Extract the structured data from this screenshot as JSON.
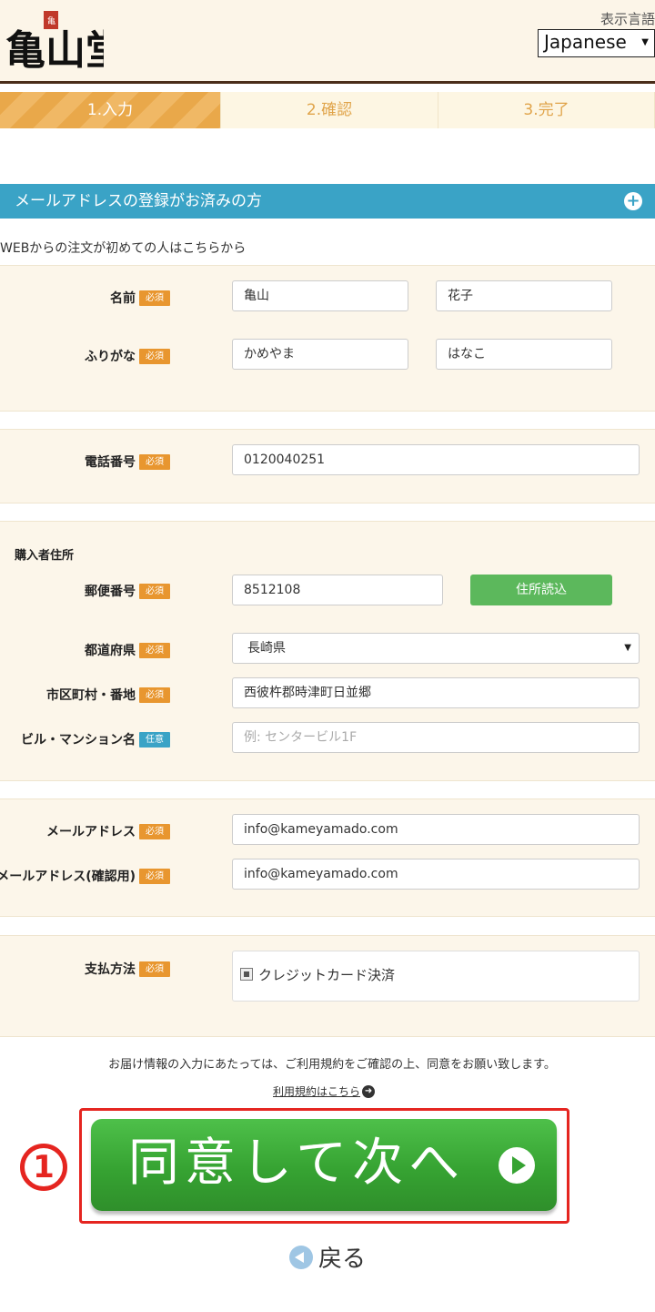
{
  "header": {
    "logo_alt": "亀山堂",
    "lang_label": "表示言語",
    "lang_selected": "Japanese"
  },
  "steps": [
    {
      "label": "1.入力",
      "active": true
    },
    {
      "label": "2.確認",
      "active": false
    },
    {
      "label": "3.完了",
      "active": false
    }
  ],
  "registered_bar": "メールアドレスの登録がお済みの方",
  "first_note": "WEBからの注文が初めての人はこちらから",
  "badges": {
    "required": "必須",
    "optional": "任意"
  },
  "name_section": {
    "name_label": "名前",
    "last_name": "亀山",
    "first_name": "花子",
    "kana_label": "ふりがな",
    "last_kana": "かめやま",
    "first_kana": "はなこ"
  },
  "phone_section": {
    "label": "電話番号",
    "value": "0120040251"
  },
  "address_section": {
    "title": "購入者住所",
    "zip_label": "郵便番号",
    "zip_value": "8512108",
    "zip_button": "住所読込",
    "pref_label": "都道府県",
    "pref_value": "長崎県",
    "city_label": "市区町村・番地",
    "city_value": "西彼杵郡時津町日並郷",
    "building_label": "ビル・マンション名",
    "building_placeholder": "例: センタービル1F"
  },
  "email_section": {
    "email_label": "メールアドレス",
    "email_value": "info@kameyamado.com",
    "confirm_label": "メールアドレス(確認用)",
    "confirm_value": "info@kameyamado.com"
  },
  "payment_section": {
    "label": "支払方法",
    "option": "クレジットカード決済"
  },
  "agree_text": "お届け情報の入力にあたっては、ご利用規約をご確認の上、同意をお願い致します。",
  "terms_link": "利用規約はこちら",
  "annotation": "1",
  "next_button": "同意して次へ",
  "back_link": "戻る",
  "colors": {
    "accent_blue": "#3aa3c6",
    "required_orange": "#e8962f",
    "button_green": "#36a332",
    "highlight_red": "#e52520"
  }
}
